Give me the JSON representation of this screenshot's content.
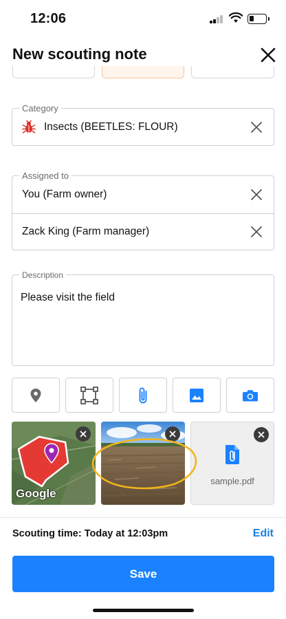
{
  "status_bar": {
    "time": "12:06"
  },
  "header": {
    "title": "New scouting note"
  },
  "category": {
    "legend": "Category",
    "value": "Insects (BEETLES: FLOUR)",
    "icon": "bug-icon",
    "icon_color": "#d9302c"
  },
  "assigned": {
    "legend": "Assigned to",
    "items": [
      {
        "label": "You (Farm owner)"
      },
      {
        "label": "Zack King (Farm manager)"
      }
    ]
  },
  "description": {
    "legend": "Description",
    "value": "Please visit the field"
  },
  "tools": [
    {
      "name": "location-button",
      "icon": "location-pin-icon"
    },
    {
      "name": "area-button",
      "icon": "area-select-icon"
    },
    {
      "name": "attach-button",
      "icon": "paperclip-icon"
    },
    {
      "name": "gallery-button",
      "icon": "image-icon"
    },
    {
      "name": "camera-button",
      "icon": "camera-icon"
    }
  ],
  "attachments": {
    "map_logo": "Google",
    "pdf_name": "sample.pdf"
  },
  "footer": {
    "scouting_time": "Scouting time: Today at 12:03pm",
    "edit_label": "Edit",
    "save_label": "Save"
  },
  "colors": {
    "accent": "#1a82ff",
    "link": "#1a7fe6",
    "annotation": "#f2b51d",
    "field_marker": "#9b27b0"
  }
}
